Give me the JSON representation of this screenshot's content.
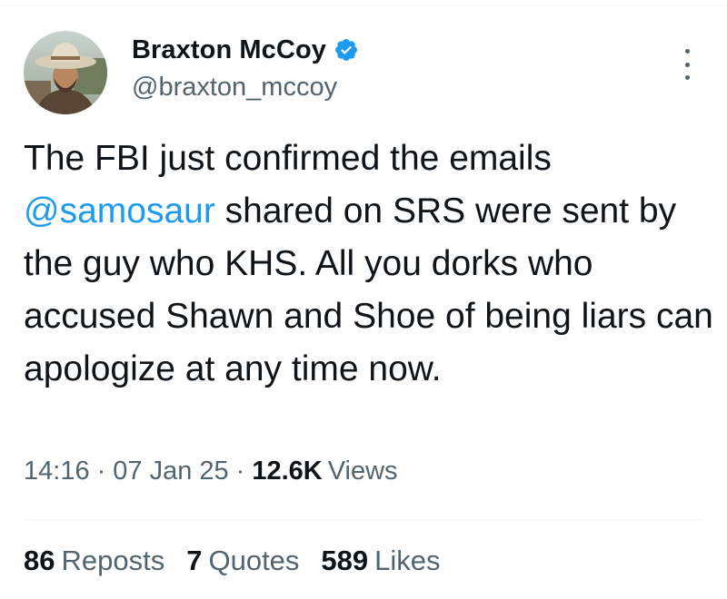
{
  "author": {
    "display_name": "Braxton McCoy",
    "handle": "@braxton_mccoy",
    "verified_icon": "verified-badge-icon",
    "avatar_alt": "profile-photo"
  },
  "tweet": {
    "text_part1": "The FBI just confirmed the emails ",
    "mention": "@samosaur",
    "text_part2": " shared on SRS were sent by the guy who KHS. All you dorks who accused Shawn and Shoe of being liars can apologize at any time now."
  },
  "meta": {
    "time": "14:16",
    "separator": "·",
    "date": "07 Jan 25",
    "views_count": "12.6K",
    "views_label": "Views"
  },
  "stats": {
    "reposts_count": "86",
    "reposts_label": "Reposts",
    "quotes_count": "7",
    "quotes_label": "Quotes",
    "likes_count": "589",
    "likes_label": "Likes"
  },
  "colors": {
    "text": "#0f1419",
    "secondary": "#536471",
    "accent": "#1d9bf0"
  }
}
